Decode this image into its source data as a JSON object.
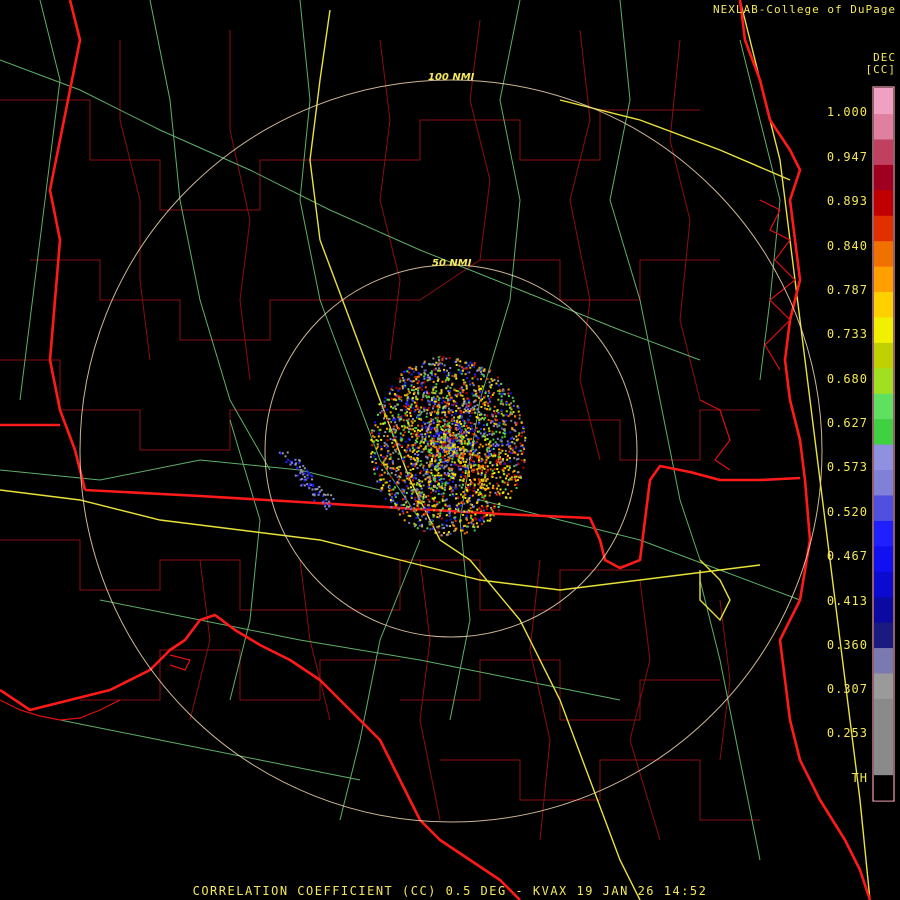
{
  "credit": "NEXLAB-College of DuPage",
  "product_unit": "DEC",
  "product_code": "[CC]",
  "footer": "CORRELATION COEFFICIENT (CC) 0.5 DEG - KVAX 19 JAN 26 14:52",
  "range_rings": [
    "100 NMI",
    "50 NMI"
  ],
  "legend": {
    "labels": [
      "1.000",
      "0.947",
      "0.893",
      "0.840",
      "0.787",
      "0.733",
      "0.680",
      "0.627",
      "0.573",
      "0.520",
      "0.467",
      "0.413",
      "0.360",
      "0.307",
      "0.253",
      "TH"
    ],
    "colors": [
      "#000000",
      "#8a8a8a",
      "#8a8a8a",
      "#8a8a8a",
      "#9a9a9a",
      "#7a7ab0",
      "#1a1a80",
      "#0a0aa0",
      "#0a0ad0",
      "#1010f0",
      "#2020ff",
      "#5050e0",
      "#8080d8",
      "#9090e0",
      "#40d040",
      "#60e060",
      "#a0e020",
      "#c0d000",
      "#f0f000",
      "#ffd000",
      "#ffa000",
      "#f07000",
      "#e03000",
      "#c00000",
      "#a00020",
      "#c04060",
      "#e080a0",
      "#f0a0c0"
    ]
  }
}
